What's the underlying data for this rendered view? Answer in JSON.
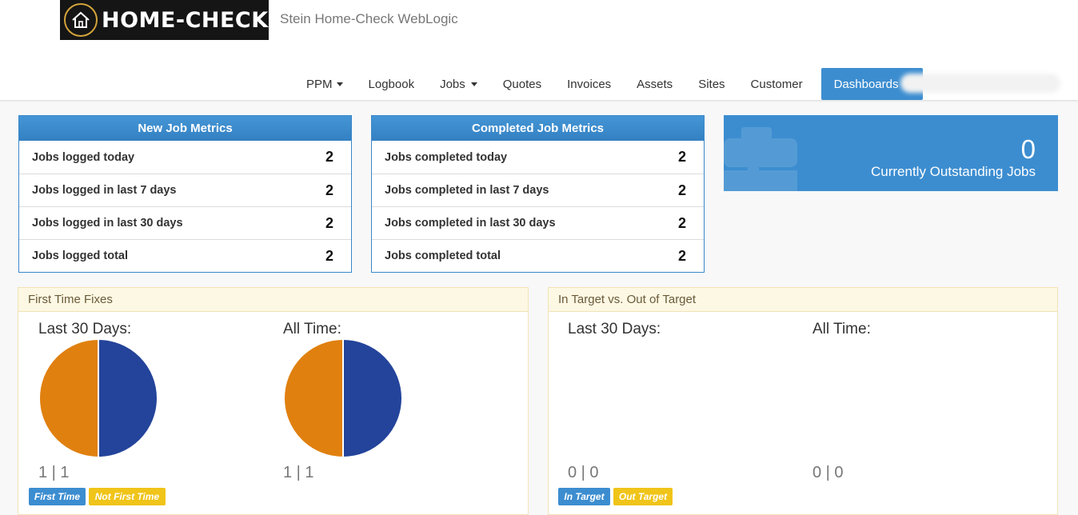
{
  "header": {
    "logo_text": "HOME-CHECK",
    "app_title": "Stein Home-Check WebLogic",
    "nav": [
      {
        "label": "PPM",
        "dropdown": true
      },
      {
        "label": "Logbook"
      },
      {
        "label": "Jobs",
        "dropdown": true
      },
      {
        "label": "Quotes"
      },
      {
        "label": "Invoices"
      },
      {
        "label": "Assets"
      },
      {
        "label": "Sites"
      },
      {
        "label": "Customer"
      },
      {
        "label": "Dashboards",
        "dropdown": true,
        "active": true
      }
    ]
  },
  "new_job_metrics": {
    "title": "New Job Metrics",
    "rows": [
      {
        "label": "Jobs logged today",
        "value": "2"
      },
      {
        "label": "Jobs logged in last 7 days",
        "value": "2"
      },
      {
        "label": "Jobs logged in last 30 days",
        "value": "2"
      },
      {
        "label": "Jobs logged total",
        "value": "2"
      }
    ]
  },
  "completed_job_metrics": {
    "title": "Completed Job Metrics",
    "rows": [
      {
        "label": "Jobs completed today",
        "value": "2"
      },
      {
        "label": "Jobs completed in last 7 days",
        "value": "2"
      },
      {
        "label": "Jobs completed in last 30 days",
        "value": "2"
      },
      {
        "label": "Jobs completed total",
        "value": "2"
      }
    ]
  },
  "outstanding": {
    "count": "0",
    "label": "Currently Outstanding Jobs",
    "icon": "briefcase-icon"
  },
  "first_time_fixes": {
    "title": "First Time Fixes",
    "last30_label": "Last 30 Days:",
    "alltime_label": "All Time:",
    "last30_counts": "1 | 1",
    "alltime_counts": "1 | 1",
    "badge_first": "First Time",
    "badge_not_first": "Not First Time"
  },
  "in_target": {
    "title": "In Target vs. Out of Target",
    "last30_label": "Last 30 Days:",
    "alltime_label": "All Time:",
    "last30_counts": "0 | 0",
    "alltime_counts": "0 | 0",
    "badge_in": "In Target",
    "badge_out": "Out Target"
  },
  "colors": {
    "primary": "#3c8dd0",
    "pie_first_time": "#23449a",
    "pie_not_first_time": "#e0800f",
    "badge_yellow": "#f0c419"
  },
  "chart_data": [
    {
      "type": "pie",
      "title": "Last 30 Days:",
      "labels": [
        "First Time",
        "Not First Time"
      ],
      "values": [
        1,
        1
      ],
      "colors": [
        "#23449a",
        "#e0800f"
      ]
    },
    {
      "type": "pie",
      "title": "All Time:",
      "labels": [
        "First Time",
        "Not First Time"
      ],
      "values": [
        1,
        1
      ],
      "colors": [
        "#23449a",
        "#e0800f"
      ]
    }
  ]
}
